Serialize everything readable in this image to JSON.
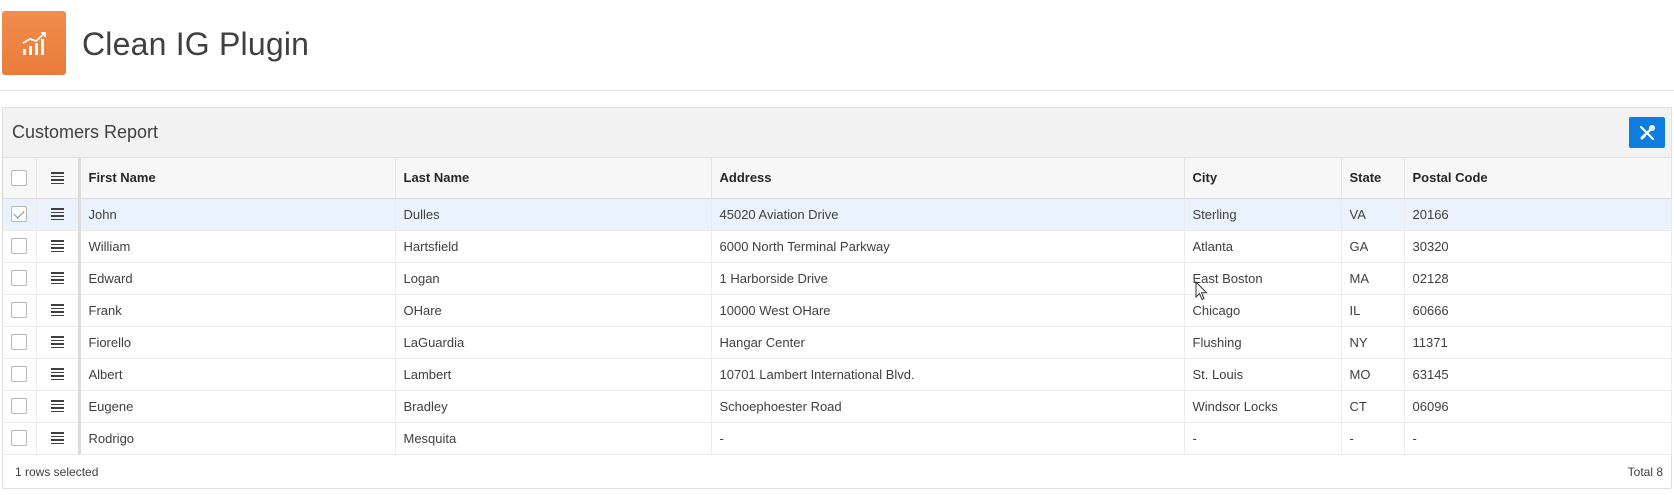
{
  "app": {
    "title": "Clean IG Plugin",
    "icon": "chart-icon",
    "icon_color": "#ef8a4a"
  },
  "region": {
    "title": "Customers Report",
    "tool_icon": "tools-icon",
    "tool_color": "#0d7ee0"
  },
  "grid": {
    "columns": [
      "First Name",
      "Last Name",
      "Address",
      "City",
      "State",
      "Postal Code"
    ],
    "rows": [
      {
        "selected": true,
        "cells": [
          "John",
          "Dulles",
          "45020 Aviation Drive",
          "Sterling",
          "VA",
          "20166"
        ]
      },
      {
        "selected": false,
        "cells": [
          "William",
          "Hartsfield",
          "6000 North Terminal Parkway",
          "Atlanta",
          "GA",
          "30320"
        ]
      },
      {
        "selected": false,
        "cells": [
          "Edward",
          "Logan",
          "1 Harborside Drive",
          "East Boston",
          "MA",
          "02128"
        ]
      },
      {
        "selected": false,
        "cells": [
          "Frank",
          "OHare",
          "10000 West OHare",
          "Chicago",
          "IL",
          "60666"
        ]
      },
      {
        "selected": false,
        "cells": [
          "Fiorello",
          "LaGuardia",
          "Hangar Center",
          "Flushing",
          "NY",
          "11371"
        ]
      },
      {
        "selected": false,
        "cells": [
          "Albert",
          "Lambert",
          "10701 Lambert International Blvd.",
          "St. Louis",
          "MO",
          "63145"
        ]
      },
      {
        "selected": false,
        "cells": [
          "Eugene",
          "Bradley",
          "Schoephoester Road",
          "Windsor Locks",
          "CT",
          "06096"
        ]
      },
      {
        "selected": false,
        "cells": [
          "Rodrigo",
          "Mesquita",
          "-",
          "-",
          "-",
          "-"
        ]
      }
    ]
  },
  "footer": {
    "selection_text": "1 rows selected",
    "total_text": "Total 8"
  }
}
